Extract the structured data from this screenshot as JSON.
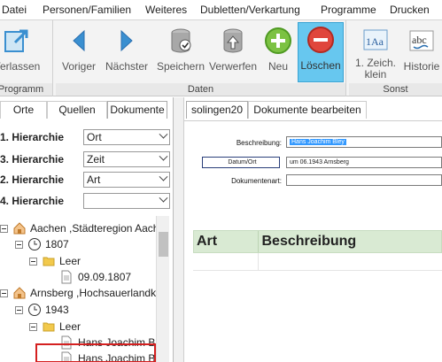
{
  "menu": [
    "Datei",
    "Personen/Familien",
    "Weiteres",
    "Dubletten/Verkartung",
    "Programme",
    "Drucken"
  ],
  "ribbon": {
    "programm_group": {
      "label": "Programm",
      "buttons": [
        {
          "label": "Verlassen",
          "icon": "exit-icon"
        }
      ]
    },
    "daten_group": {
      "label": "Daten",
      "buttons": [
        {
          "label": "Voriger",
          "icon": "arrow-left-icon"
        },
        {
          "label": "Nächster",
          "icon": "arrow-right-icon"
        },
        {
          "label": "Speichern",
          "icon": "save-db-icon"
        },
        {
          "label": "Verwerfen",
          "icon": "discard-db-icon"
        },
        {
          "label": "Neu",
          "icon": "plus-icon"
        },
        {
          "label": "Löschen",
          "icon": "minus-icon"
        }
      ]
    },
    "sonst_group": {
      "label": "Sonst",
      "buttons": [
        {
          "label": "1. Zeich.",
          "label2": "klein",
          "icon": "case-icon",
          "icon_text": "1Aa"
        },
        {
          "label": "Historie",
          "icon": "spellcheck-icon",
          "icon_text": "abc"
        }
      ]
    }
  },
  "left": {
    "tabs": [
      "Orte",
      "Quellen",
      "Dokumente"
    ],
    "selected_tab": "Dokumente",
    "hierarchies": [
      {
        "label": "1. Hierarchie",
        "value": "Ort"
      },
      {
        "label": "3. Hierarchie",
        "value": "Zeit"
      },
      {
        "label": "2. Hierarchie",
        "value": "Art"
      },
      {
        "label": "4. Hierarchie",
        "value": ""
      }
    ],
    "tree": [
      {
        "text": "Aachen ,Städteregion Aach",
        "icon": "house-icon",
        "level": 0,
        "expander": true
      },
      {
        "text": "1807",
        "icon": "clock-icon",
        "level": 1,
        "expander": true
      },
      {
        "text": "Leer",
        "icon": "folder-icon",
        "level": 2,
        "expander": true
      },
      {
        "text": "09.09.1807",
        "icon": "document-icon",
        "level": 3,
        "expander": false
      },
      {
        "text": "Arnsberg ,Hochsauerlandk",
        "icon": "house-icon",
        "level": 0,
        "expander": true
      },
      {
        "text": "1943",
        "icon": "clock-icon",
        "level": 1,
        "expander": true
      },
      {
        "text": "Leer",
        "icon": "folder-icon",
        "level": 2,
        "expander": true
      },
      {
        "text": "Hans Joachim B",
        "icon": "document-icon",
        "level": 3,
        "expander": false
      },
      {
        "text": "Hans Joachim B",
        "icon": "document-icon",
        "level": 3,
        "expander": false
      }
    ]
  },
  "right": {
    "tabs": [
      "solingen20",
      "Dokumente bearbeiten"
    ],
    "selected_tab": "solingen20",
    "fields": {
      "beschreibung_label": "Beschreibung:",
      "beschreibung_value": "Hans Joachim Bley",
      "datum_label": "Datum/Ort",
      "datum_value": "um 06.1943 Arnsberg",
      "dokumentenart_label": "Dokumentenart:",
      "dokumentenart_value": ""
    },
    "grid": {
      "columns": [
        "Art",
        "Beschreibung"
      ]
    }
  },
  "colors": {
    "active_button": "#67c7ef",
    "grid_header": "#d9ead3",
    "highlight_box": "#d42020",
    "selected_text": "#3399ff"
  }
}
